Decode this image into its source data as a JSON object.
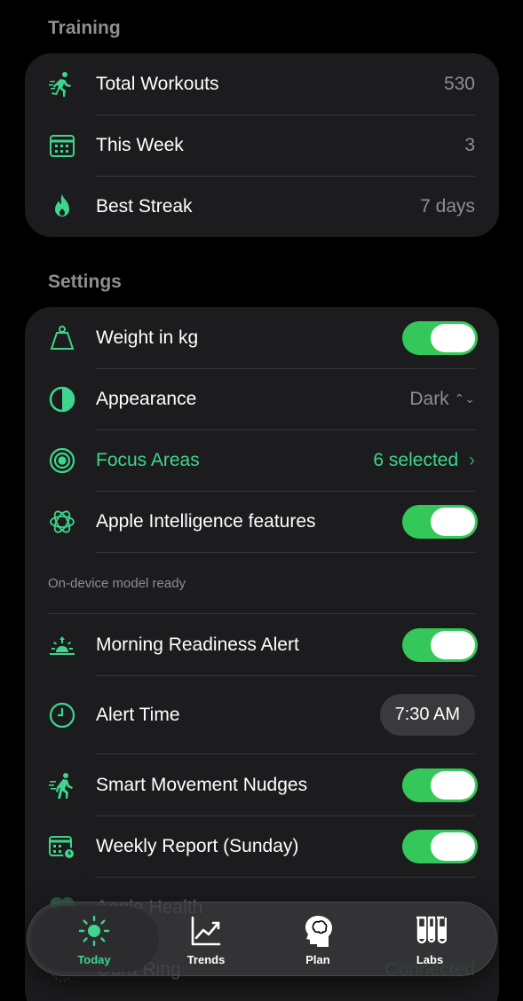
{
  "training": {
    "title": "Training",
    "rows": [
      {
        "label": "Total Workouts",
        "value": "530",
        "icon": "running-icon"
      },
      {
        "label": "This Week",
        "value": "3",
        "icon": "calendar-icon"
      },
      {
        "label": "Best Streak",
        "value": "7 days",
        "icon": "flame-icon"
      }
    ]
  },
  "settings": {
    "title": "Settings",
    "weight": {
      "label": "Weight in kg",
      "toggle_on": true,
      "icon": "scale-icon"
    },
    "appearance": {
      "label": "Appearance",
      "value": "Dark",
      "icon": "half-circle-icon",
      "chevron": "⌃⌄"
    },
    "focus": {
      "label": "Focus Areas",
      "value": "6 selected",
      "icon": "target-icon",
      "chevron": "›"
    },
    "intelligence": {
      "label": "Apple Intelligence features",
      "toggle_on": true,
      "icon": "ai-flower-icon"
    },
    "note": "On-device model ready",
    "morning": {
      "label": "Morning Readiness Alert",
      "toggle_on": true,
      "icon": "sunrise-icon"
    },
    "alert_time": {
      "label": "Alert Time",
      "value": "7:30 AM",
      "icon": "clock-icon"
    },
    "nudges": {
      "label": "Smart Movement Nudges",
      "toggle_on": true,
      "icon": "walking-icon"
    },
    "weekly": {
      "label": "Weekly Report (Sunday)",
      "toggle_on": true,
      "icon": "calendar-clock-icon"
    },
    "health": {
      "label": "Apple Health",
      "icon": "heart-icon"
    },
    "oura": {
      "label": "Oura Ring",
      "value": "Connected",
      "icon": "ring-icon"
    }
  },
  "tabs": [
    {
      "label": "Today",
      "icon": "sun-icon",
      "active": true
    },
    {
      "label": "Trends",
      "icon": "chart-icon",
      "active": false
    },
    {
      "label": "Plan",
      "icon": "brain-head-icon",
      "active": false
    },
    {
      "label": "Labs",
      "icon": "test-tubes-icon",
      "active": false
    }
  ],
  "colors": {
    "accent": "#3dd68c",
    "toggle": "#34c759",
    "card": "#1c1c1e",
    "background": "#000000"
  }
}
